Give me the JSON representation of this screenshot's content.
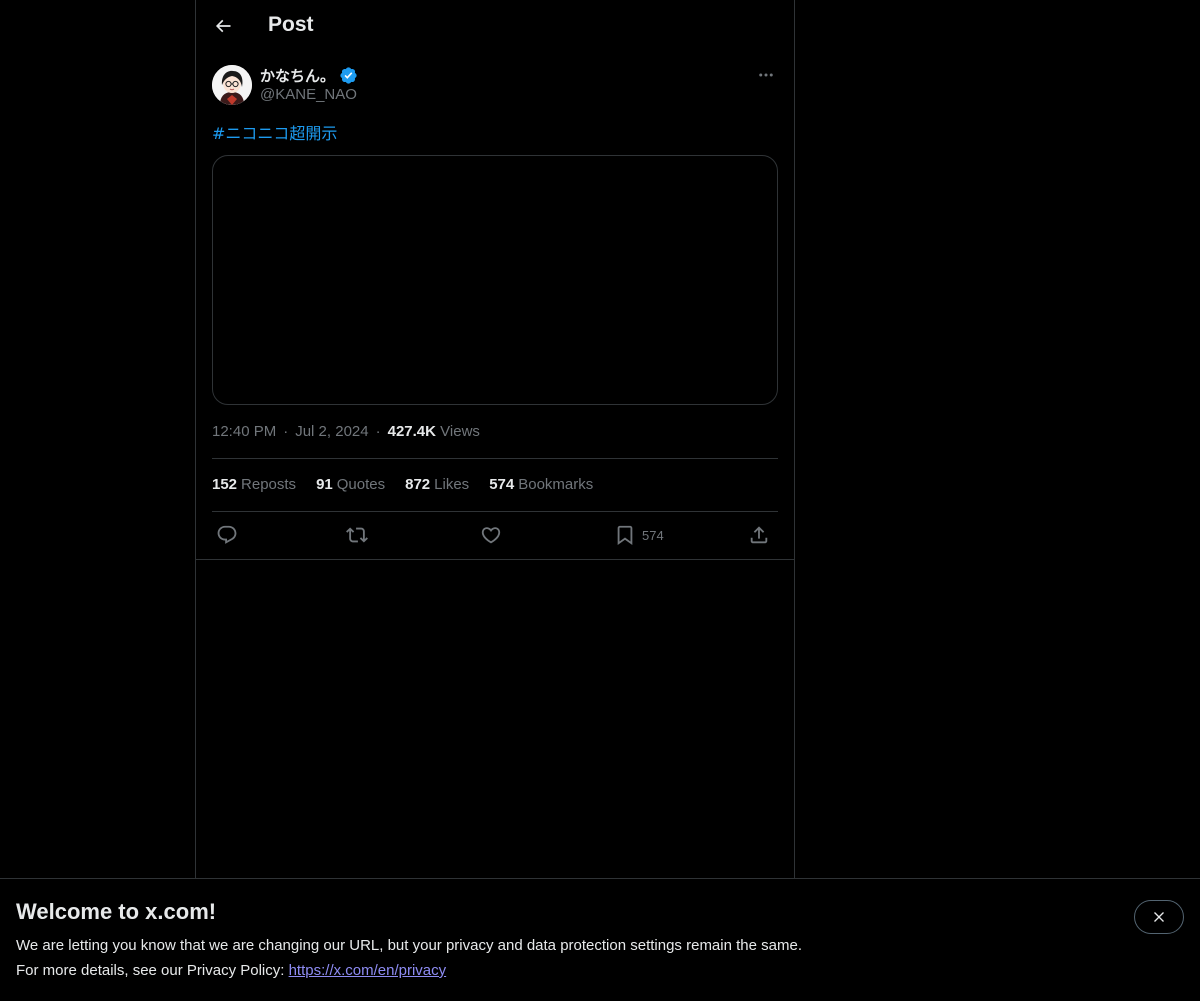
{
  "header": {
    "title": "Post",
    "back_icon": "arrow-left-icon"
  },
  "author": {
    "display_name": "かなちん。",
    "handle": "@KANE_NAO",
    "verified": true,
    "verified_color": "#1d9bf0"
  },
  "post": {
    "hashtag": "#ニコニコ超開示",
    "time": "12:40 PM",
    "date": "Jul 2, 2024",
    "views_count": "427.4K",
    "views_label": "Views",
    "separator": "·"
  },
  "stats": [
    {
      "count": "152",
      "label": "Reposts"
    },
    {
      "count": "91",
      "label": "Quotes"
    },
    {
      "count": "872",
      "label": "Likes"
    },
    {
      "count": "574",
      "label": "Bookmarks"
    }
  ],
  "actions": {
    "reply_icon": "reply-icon",
    "repost_icon": "repost-icon",
    "like_icon": "heart-icon",
    "bookmark_icon": "bookmark-icon",
    "bookmark_count": "574",
    "share_icon": "share-icon"
  },
  "banner": {
    "title": "Welcome to x.com!",
    "line1": "We are letting you know that we are changing our URL, but your privacy and data protection settings remain the same.",
    "line2_prefix": "For more details, see our Privacy Policy: ",
    "link": "https://x.com/en/privacy",
    "close_icon": "close-icon"
  },
  "colors": {
    "background": "#000000",
    "text": "#e7e9ea",
    "muted": "#71767b",
    "accent": "#1d9bf0",
    "border": "#2f3336"
  }
}
